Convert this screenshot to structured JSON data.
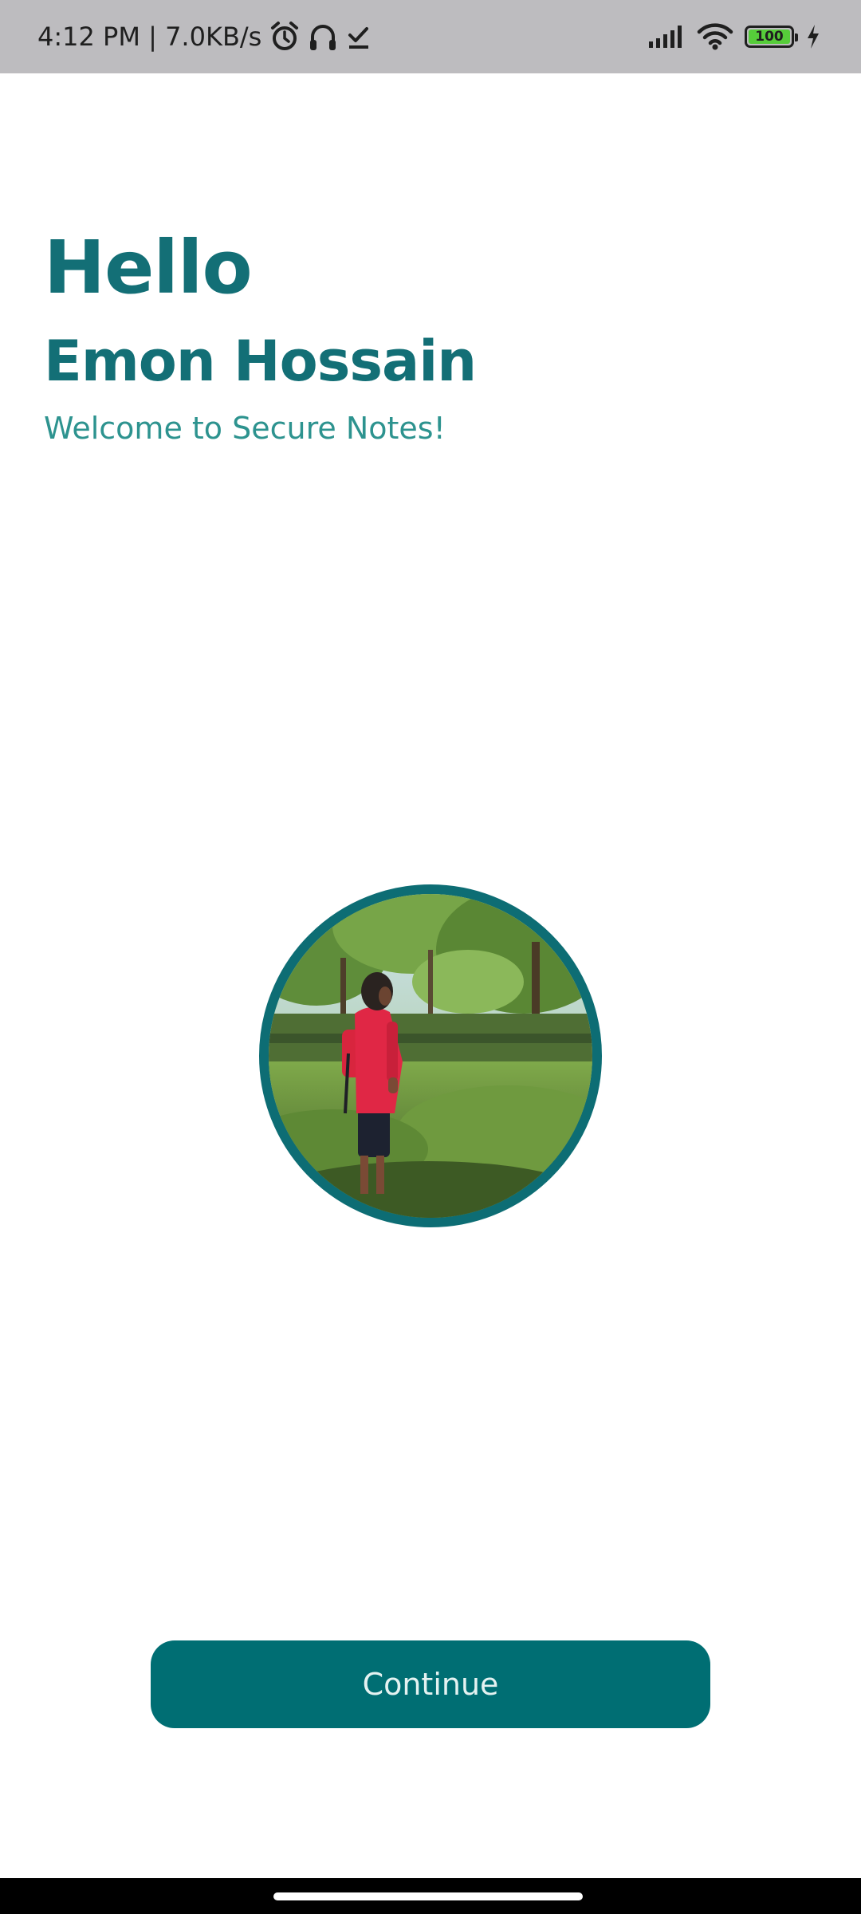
{
  "status_bar": {
    "time_speed": "4:12 PM | 7.0KB/s",
    "battery_level": "100",
    "icons": [
      "alarm-icon",
      "headphones-icon",
      "check-icon",
      "signal-icon",
      "wifi-icon",
      "battery-icon",
      "charging-icon"
    ]
  },
  "greeting": {
    "hello": "Hello",
    "name": "Emon Hossain",
    "welcome": "Welcome to Secure Notes!"
  },
  "avatar": {
    "ring_color": "#0d6d74"
  },
  "continue_button": {
    "label": "Continue",
    "color": "#006e73"
  },
  "theme": {
    "primary": "#136f76",
    "secondary_text": "#2d938f",
    "status_bar_bg": "#bdbcbf"
  }
}
